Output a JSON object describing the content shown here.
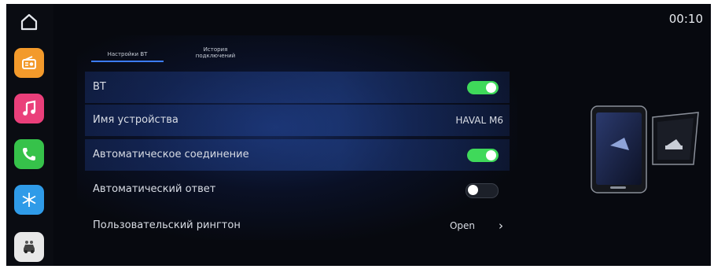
{
  "status": {
    "time": "00:10"
  },
  "tabs": [
    {
      "label": "Настройки BT",
      "active": true
    },
    {
      "label": "История\nподключений",
      "active": false
    }
  ],
  "settings": [
    {
      "label": "BT",
      "type": "toggle",
      "state": "on"
    },
    {
      "label": "Имя устройства",
      "type": "value",
      "value": "HAVAL M6"
    },
    {
      "label": "Автоматическое соединение",
      "type": "toggle",
      "state": "on"
    },
    {
      "label": "Автоматический ответ",
      "type": "toggle",
      "state": "off"
    },
    {
      "label": "Пользовательский рингтон",
      "type": "link",
      "value": "Open"
    }
  ],
  "sidebar": {
    "icons": [
      {
        "name": "home-icon"
      },
      {
        "name": "radio-icon",
        "color": "#f39a2b"
      },
      {
        "name": "music-icon",
        "color": "#ea3f7a"
      },
      {
        "name": "phone-icon",
        "color": "#36c24a"
      },
      {
        "name": "climate-icon",
        "color": "#2f9be8"
      },
      {
        "name": "car-settings-icon",
        "color": "#e8e8e8"
      }
    ]
  },
  "colors": {
    "accent": "#3c7cff",
    "toggle_on": "#3fd95a",
    "background": "#07090f"
  }
}
